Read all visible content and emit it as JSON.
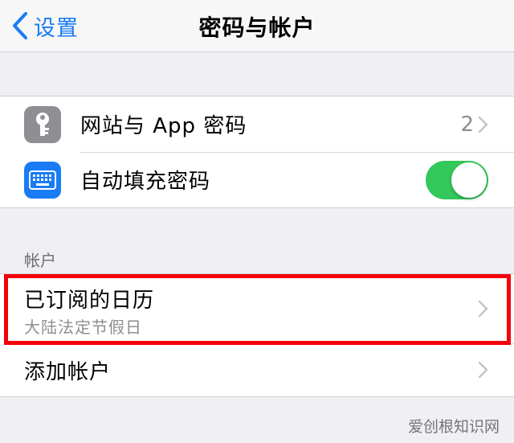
{
  "nav": {
    "back_label": "设置",
    "title": "密码与帐户"
  },
  "passwords_group": {
    "website_passwords": {
      "label": "网站与 App 密码",
      "count": "2",
      "icon": "key-icon"
    },
    "autofill": {
      "label": "自动填充密码",
      "enabled": true,
      "icon": "keyboard-icon"
    }
  },
  "accounts_section": {
    "header": "帐户",
    "items": [
      {
        "title": "已订阅的日历",
        "subtitle": "大陆法定节假日"
      },
      {
        "title": "添加帐户"
      }
    ]
  },
  "watermark": "爱创根知识网",
  "colors": {
    "accent": "#1a7cf5",
    "toggle_on": "#34c759",
    "highlight_border": "#f5000a",
    "key_icon_bg": "#8e8e93",
    "keyboard_icon_bg": "#1a7cf5"
  }
}
